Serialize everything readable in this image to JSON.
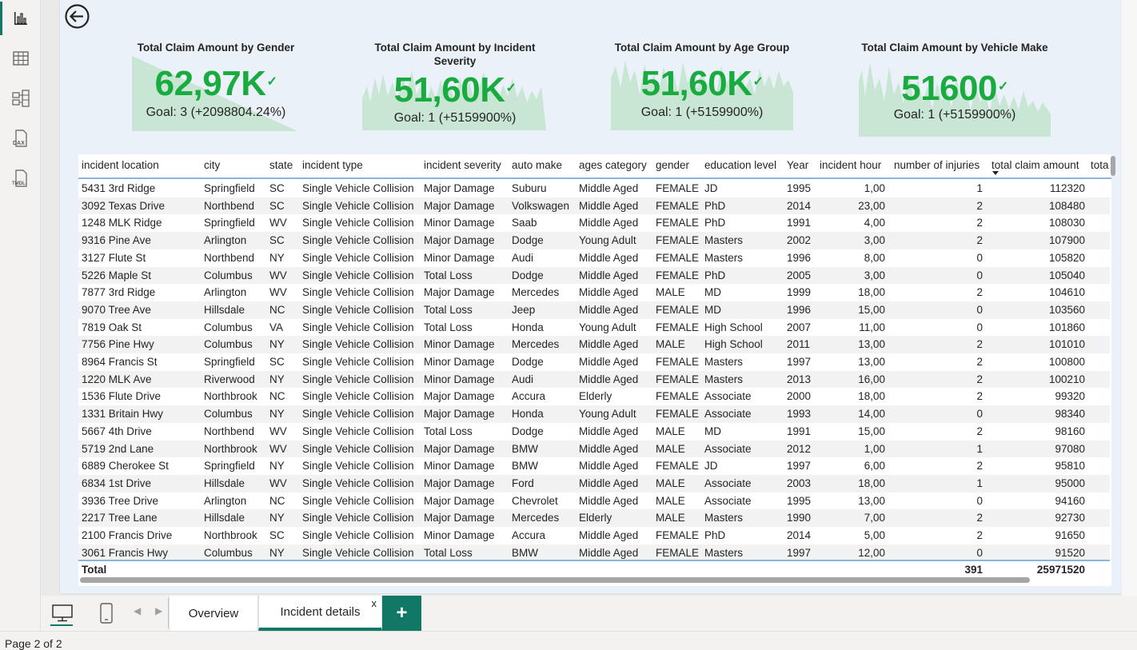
{
  "rail": {
    "items": [
      {
        "name": "report-view",
        "icon": "bar-chart-icon"
      },
      {
        "name": "table-view",
        "icon": "table-grid-icon"
      },
      {
        "name": "model-view",
        "icon": "model-diagram-icon"
      },
      {
        "name": "dax-query-view",
        "icon": "dax-icon",
        "label": "DAX"
      },
      {
        "name": "tmdl-view",
        "icon": "tmdl-icon",
        "label": "TMDL"
      }
    ]
  },
  "kpis": [
    {
      "title": "Total Claim Amount by Gender",
      "value": "62,97K",
      "goal": "Goal: 3 (+2098804.24%)"
    },
    {
      "title": "Total Claim Amount by Incident Severity",
      "value": "51,60K",
      "goal": "Goal: 1 (+5159900%)"
    },
    {
      "title": "Total Claim Amount by Age Group",
      "value": "51,60K",
      "goal": "Goal: 1 (+5159900%)"
    },
    {
      "title": "Total Claim Amount by Vehicle Make",
      "value": "51600",
      "goal": "Goal: 1 (+5159900%)"
    }
  ],
  "kpi_colors": {
    "value": "#1aab40",
    "sparkline": "#c8e6d3"
  },
  "table": {
    "columns": [
      "incident location",
      "city",
      "state",
      "incident type",
      "incident severity",
      "auto make",
      "ages category",
      "gender",
      "education level",
      "Year",
      "incident hour",
      "number of injuries",
      "total claim amount",
      "tota"
    ],
    "rows": [
      [
        "5431 3rd Ridge",
        "Springfield",
        "SC",
        "Single Vehicle Collision",
        "Major Damage",
        "Suburu",
        "Middle Aged",
        "FEMALE",
        "JD",
        "1995",
        "1,00",
        "1",
        "112320"
      ],
      [
        "3092 Texas Drive",
        "Northbend",
        "SC",
        "Single Vehicle Collision",
        "Major Damage",
        "Volkswagen",
        "Middle Aged",
        "FEMALE",
        "PhD",
        "2014",
        "23,00",
        "2",
        "108480"
      ],
      [
        "1248 MLK Ridge",
        "Springfield",
        "WV",
        "Single Vehicle Collision",
        "Minor Damage",
        "Saab",
        "Middle Aged",
        "FEMALE",
        "PhD",
        "1991",
        "4,00",
        "2",
        "108030"
      ],
      [
        "9316 Pine Ave",
        "Arlington",
        "SC",
        "Single Vehicle Collision",
        "Major Damage",
        "Dodge",
        "Young Adult",
        "FEMALE",
        "Masters",
        "2002",
        "3,00",
        "2",
        "107900"
      ],
      [
        "3127 Flute St",
        "Northbend",
        "NY",
        "Single Vehicle Collision",
        "Minor Damage",
        "Audi",
        "Middle Aged",
        "FEMALE",
        "Masters",
        "1996",
        "8,00",
        "0",
        "105820"
      ],
      [
        "5226 Maple St",
        "Columbus",
        "WV",
        "Single Vehicle Collision",
        "Total Loss",
        "Dodge",
        "Middle Aged",
        "FEMALE",
        "PhD",
        "2005",
        "3,00",
        "0",
        "105040"
      ],
      [
        "7877 3rd Ridge",
        "Arlington",
        "WV",
        "Single Vehicle Collision",
        "Major Damage",
        "Mercedes",
        "Middle Aged",
        "MALE",
        "MD",
        "1999",
        "18,00",
        "2",
        "104610"
      ],
      [
        "9070 Tree Ave",
        "Hillsdale",
        "NC",
        "Single Vehicle Collision",
        "Total Loss",
        "Jeep",
        "Middle Aged",
        "FEMALE",
        "MD",
        "1996",
        "15,00",
        "0",
        "103560"
      ],
      [
        "7819 Oak St",
        "Columbus",
        "VA",
        "Single Vehicle Collision",
        "Total Loss",
        "Honda",
        "Young Adult",
        "FEMALE",
        "High School",
        "2007",
        "11,00",
        "0",
        "101860"
      ],
      [
        "7756 Pine Hwy",
        "Columbus",
        "NY",
        "Single Vehicle Collision",
        "Minor Damage",
        "Mercedes",
        "Middle Aged",
        "MALE",
        "High School",
        "2011",
        "13,00",
        "2",
        "101010"
      ],
      [
        "8964 Francis St",
        "Springfield",
        "SC",
        "Single Vehicle Collision",
        "Minor Damage",
        "Dodge",
        "Middle Aged",
        "FEMALE",
        "Masters",
        "1997",
        "13,00",
        "2",
        "100800"
      ],
      [
        "1220 MLK Ave",
        "Riverwood",
        "NY",
        "Single Vehicle Collision",
        "Minor Damage",
        "Audi",
        "Middle Aged",
        "FEMALE",
        "Masters",
        "2013",
        "16,00",
        "2",
        "100210"
      ],
      [
        "1536 Flute Drive",
        "Northbrook",
        "NC",
        "Single Vehicle Collision",
        "Major Damage",
        "Accura",
        "Elderly",
        "FEMALE",
        "Associate",
        "2000",
        "18,00",
        "2",
        "99320"
      ],
      [
        "1331 Britain Hwy",
        "Columbus",
        "NY",
        "Single Vehicle Collision",
        "Major Damage",
        "Honda",
        "Young Adult",
        "FEMALE",
        "Associate",
        "1993",
        "14,00",
        "0",
        "98340"
      ],
      [
        "5667 4th Drive",
        "Northbend",
        "WV",
        "Single Vehicle Collision",
        "Total Loss",
        "Dodge",
        "Middle Aged",
        "MALE",
        "MD",
        "1991",
        "15,00",
        "2",
        "98160"
      ],
      [
        "5719 2nd Lane",
        "Northbrook",
        "WV",
        "Single Vehicle Collision",
        "Major Damage",
        "BMW",
        "Middle Aged",
        "MALE",
        "Associate",
        "2012",
        "1,00",
        "1",
        "97080"
      ],
      [
        "6889 Cherokee St",
        "Springfield",
        "NY",
        "Single Vehicle Collision",
        "Minor Damage",
        "BMW",
        "Middle Aged",
        "FEMALE",
        "JD",
        "1997",
        "6,00",
        "2",
        "95810"
      ],
      [
        "6834 1st Drive",
        "Hillsdale",
        "WV",
        "Single Vehicle Collision",
        "Major Damage",
        "Ford",
        "Middle Aged",
        "MALE",
        "Associate",
        "2003",
        "18,00",
        "1",
        "95000"
      ],
      [
        "3936 Tree Drive",
        "Arlington",
        "NC",
        "Single Vehicle Collision",
        "Major Damage",
        "Chevrolet",
        "Middle Aged",
        "MALE",
        "Associate",
        "1995",
        "13,00",
        "0",
        "94160"
      ],
      [
        "2217 Tree Lane",
        "Hillsdale",
        "NY",
        "Single Vehicle Collision",
        "Major Damage",
        "Mercedes",
        "Elderly",
        "MALE",
        "Masters",
        "1990",
        "7,00",
        "2",
        "92730"
      ],
      [
        "2100 Francis Drive",
        "Northbrook",
        "SC",
        "Single Vehicle Collision",
        "Minor Damage",
        "Accura",
        "Middle Aged",
        "FEMALE",
        "PhD",
        "2014",
        "5,00",
        "2",
        "91650"
      ],
      [
        "3061 Francis Hwy",
        "Columbus",
        "NY",
        "Single Vehicle Collision",
        "Total Loss",
        "BMW",
        "Middle Aged",
        "FEMALE",
        "Masters",
        "1997",
        "12,00",
        "0",
        "91520"
      ]
    ],
    "totals": {
      "label": "Total",
      "injuries": "391",
      "claim": "25971520"
    }
  },
  "tabs": [
    {
      "label": "Overview",
      "active": false
    },
    {
      "label": "Incident details",
      "active": true,
      "close": "x"
    }
  ],
  "add_tab_label": "+",
  "status": {
    "page": "Page 2 of 2"
  },
  "accent": "#117865"
}
